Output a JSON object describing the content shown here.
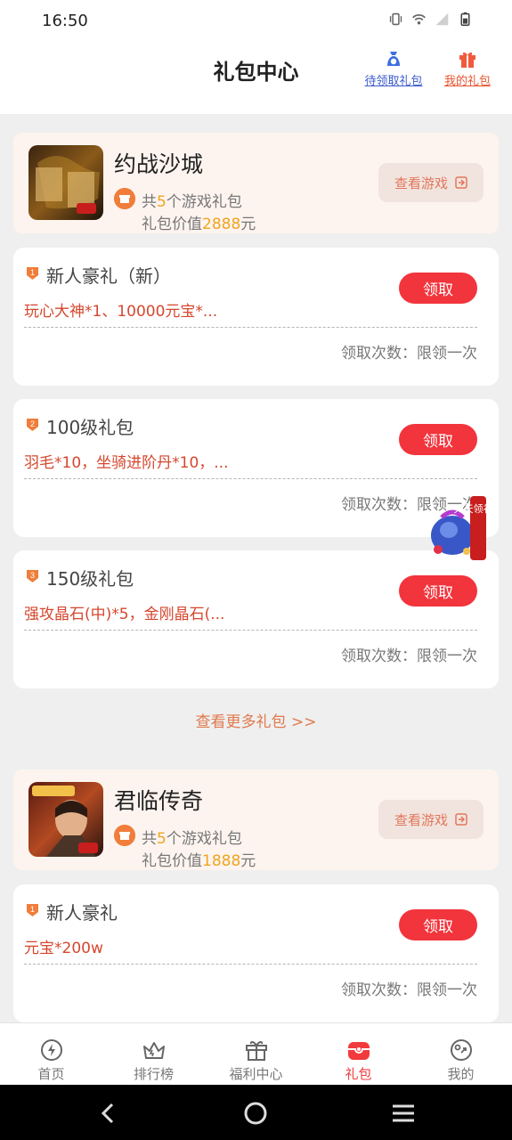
{
  "status_bar": {
    "time": "16:50"
  },
  "header": {
    "title": "礼包中心",
    "pending_label": "待领取礼包",
    "mine_label": "我的礼包"
  },
  "games": [
    {
      "name": "约战沙城",
      "count_prefix": "共",
      "count": "5",
      "count_suffix": "个游戏礼包",
      "value_prefix": "礼包价值",
      "value": "2888",
      "value_suffix": "元",
      "view_label": "查看游戏",
      "gifts": [
        {
          "rank": "1",
          "name": "新人豪礼（新）",
          "desc": "玩心大神*1、10000元宝*...",
          "claim": "领取",
          "limit": "领取次数：限领一次"
        },
        {
          "rank": "2",
          "name": "100级礼包",
          "desc": "羽毛*10，坐骑进阶丹*10，...",
          "claim": "领取",
          "limit": "领取次数：限领一次"
        },
        {
          "rank": "3",
          "name": "150级礼包",
          "desc": "强攻晶石(中)*5，金刚晶石(...",
          "claim": "领取",
          "limit": "领取次数：限领一次"
        }
      ]
    },
    {
      "name": "君临传奇",
      "count_prefix": "共",
      "count": "5",
      "count_suffix": "个游戏礼包",
      "value_prefix": "礼包价值",
      "value": "1888",
      "value_suffix": "元",
      "view_label": "查看游戏",
      "gifts": [
        {
          "rank": "1",
          "name": "新人豪礼",
          "desc": "元宝*200w",
          "claim": "领取",
          "limit": "领取次数：限领一次"
        }
      ]
    }
  ],
  "more_label": "查看更多礼包 >>",
  "floating_label": "天天领礼包",
  "tabs": [
    {
      "label": "首页",
      "icon": "home-icon"
    },
    {
      "label": "排行榜",
      "icon": "crown-icon"
    },
    {
      "label": "福利中心",
      "icon": "gift-box-icon"
    },
    {
      "label": "礼包",
      "icon": "gift-bag-icon",
      "active": true
    },
    {
      "label": "我的",
      "icon": "profile-icon"
    }
  ],
  "colors": {
    "accent_red": "#f2343c",
    "highlight": "#f0a41f",
    "card_bg": "#fdf4ef"
  }
}
